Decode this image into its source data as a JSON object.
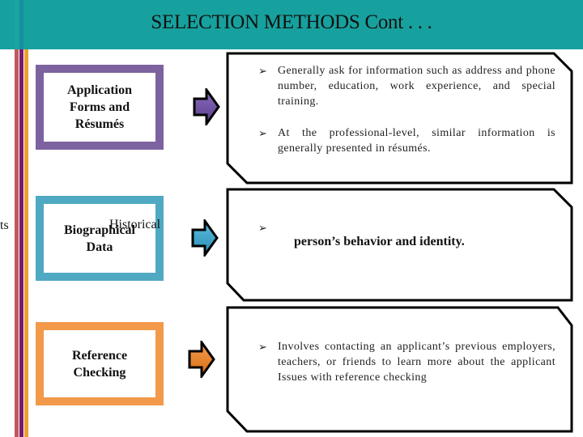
{
  "slide": {
    "title": "SELECTION METHODS Cont . . .",
    "side_fragment": "ts",
    "colors": {
      "header": "#17a19e",
      "stripe_red": "#c05a5a",
      "stripe_purple": "#7a1a70",
      "stripe_orange": "#e8a230"
    }
  },
  "methods": [
    {
      "label_lines": [
        "Application",
        "Forms and",
        "Résumés"
      ],
      "border_color": "#7d62a0",
      "arrow_color": "#6a4f9a",
      "bullets": [
        "Generally ask for information such as address and phone number, education, work experience, and special training.",
        "At the professional-level, similar information is generally presented in résumés."
      ]
    },
    {
      "label_main": "Biographical",
      "label_overlap": "Historical",
      "label_line2": "Data",
      "border_color": "#4fa9c2",
      "arrow_color": "#3ea2c8",
      "bullet_marker_only": "",
      "bold_text": "person’s behavior and identity."
    },
    {
      "label_lines": [
        "Reference",
        "Checking"
      ],
      "border_color": "#f2994a",
      "arrow_color": "#ee7f22",
      "bullets": [
        "Involves contacting an applicant’s previous employers, teachers, or friends to learn more about the applicant   Issues with reference checking"
      ]
    }
  ],
  "icons": {
    "bullet": "➢",
    "arrow": "right-block-arrow"
  }
}
